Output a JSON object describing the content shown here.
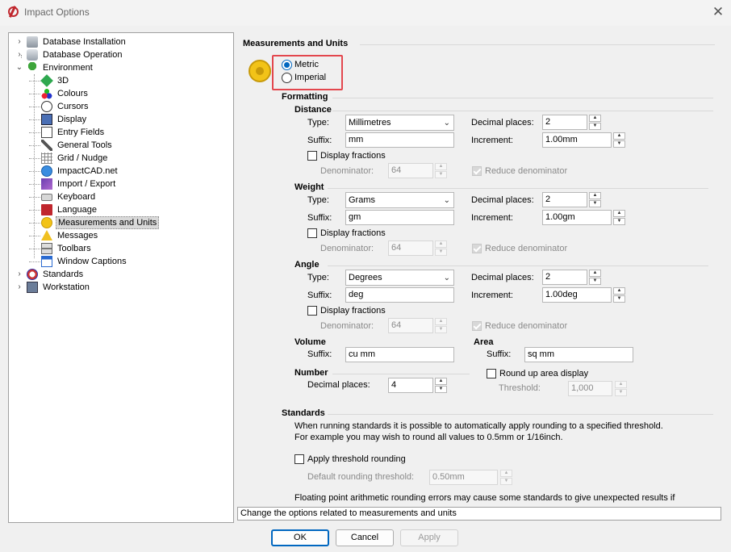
{
  "window": {
    "title": "Impact Options",
    "close": "✕"
  },
  "tree": {
    "items": [
      {
        "label": "Database Installation",
        "expander": "›",
        "icon": "database-install-icon"
      },
      {
        "label": "Database Operation",
        "expander": "›",
        "icon": "database-icon"
      },
      {
        "label": "Environment",
        "expander": "⌄",
        "icon": "tree-icon"
      },
      {
        "label": "3D",
        "icon": "cube-icon"
      },
      {
        "label": "Colours",
        "icon": "colours-icon"
      },
      {
        "label": "Cursors",
        "icon": "crosshair-icon"
      },
      {
        "label": "Display",
        "icon": "display-icon"
      },
      {
        "label": "Entry Fields",
        "icon": "entry-fields-icon"
      },
      {
        "label": "General Tools",
        "icon": "tools-icon"
      },
      {
        "label": "Grid / Nudge",
        "icon": "grid-icon"
      },
      {
        "label": "ImpactCAD.net",
        "icon": "globe-icon"
      },
      {
        "label": "Import / Export",
        "icon": "import-export-icon"
      },
      {
        "label": "Keyboard",
        "icon": "keyboard-icon"
      },
      {
        "label": "Language",
        "icon": "book-icon"
      },
      {
        "label": "Measurements and Units",
        "icon": "tape-measure-icon"
      },
      {
        "label": "Messages",
        "icon": "warning-icon"
      },
      {
        "label": "Toolbars",
        "icon": "toolbar-icon"
      },
      {
        "label": "Window Captions",
        "icon": "window-icon"
      },
      {
        "label": "Standards",
        "expander": "›",
        "icon": "standards-icon"
      },
      {
        "label": "Workstation",
        "expander": "›",
        "icon": "workstation-icon"
      }
    ]
  },
  "panel": {
    "title": "Measurements and Units",
    "system": {
      "metric": "Metric",
      "imperial": "Imperial",
      "selected": "Metric"
    },
    "formatting": "Formatting",
    "labels": {
      "type": "Type:",
      "suffix": "Suffix:",
      "decimal_places": "Decimal places:",
      "increment": "Increment:",
      "display_fractions": "Display fractions",
      "denominator": "Denominator:",
      "reduce_denominator": "Reduce denominator"
    },
    "distance": {
      "title": "Distance",
      "type": "Millimetres",
      "suffix": "mm",
      "decimal_places": "2",
      "increment": "1.00mm",
      "denominator": "64"
    },
    "weight": {
      "title": "Weight",
      "type": "Grams",
      "suffix": "gm",
      "decimal_places": "2",
      "increment": "1.00gm",
      "denominator": "64"
    },
    "angle": {
      "title": "Angle",
      "type": "Degrees",
      "suffix": "deg",
      "decimal_places": "2",
      "increment": "1.00deg",
      "denominator": "64"
    },
    "volume": {
      "title": "Volume",
      "suffix_label": "Suffix:",
      "suffix": "cu mm"
    },
    "area": {
      "title": "Area",
      "suffix_label": "Suffix:",
      "suffix": "sq mm",
      "round_up": "Round up area display",
      "threshold_label": "Threshold:",
      "threshold": "1,000"
    },
    "number": {
      "title": "Number",
      "decimal_label": "Decimal places:",
      "decimal_places": "4"
    },
    "standards": {
      "title": "Standards",
      "line1": "When running standards it is possible to automatically apply rounding to a specified threshold.",
      "line2": "For example you may wish to round all values to 0.5mm or 1/16inch.",
      "apply_threshold": "Apply threshold rounding",
      "default_label": "Default rounding threshold:",
      "default_value": "0.50mm",
      "note": "Floating point arithmetic rounding errors may cause some standards to give unexpected results if"
    }
  },
  "status": "Change the options related to measurements and units",
  "buttons": {
    "ok": "OK",
    "cancel": "Cancel",
    "apply": "Apply"
  },
  "colors": {
    "accent": "#0067c0",
    "highlight": "#e3474e"
  }
}
